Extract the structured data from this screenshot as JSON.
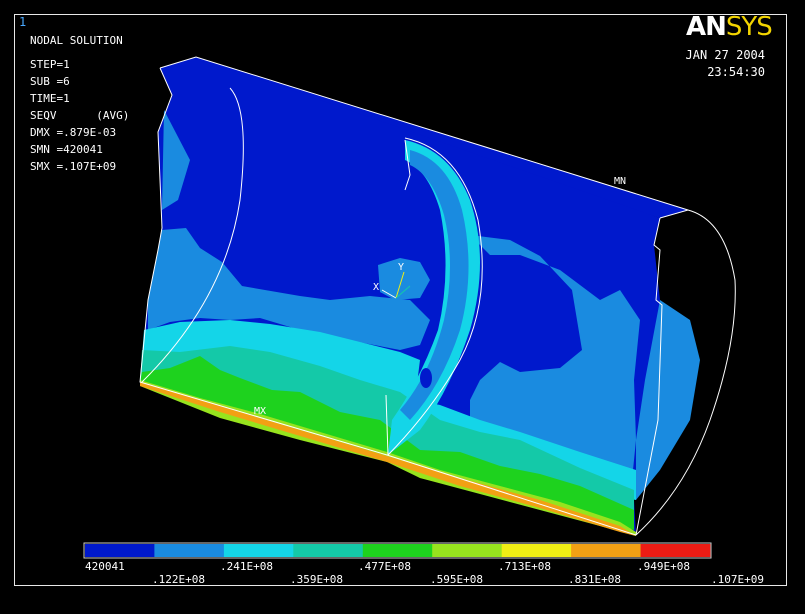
{
  "window_number": "1",
  "header": {
    "title": "NODAL SOLUTION",
    "step": "STEP=1",
    "sub": "SUB =6",
    "time": "TIME=1",
    "seqv": "SEQV      (AVG)",
    "dmx": "DMX =.879E-03",
    "smn": "SMN =420041",
    "smx": "SMX =.107E+09"
  },
  "logo": {
    "an": "AN",
    "sys": "SYS"
  },
  "datetime": {
    "date": "JAN 27 2004",
    "time": "23:54:30"
  },
  "markers": {
    "mn": "MN",
    "mx": "MX",
    "x_axis": "X",
    "y_axis": "Y"
  },
  "legend": {
    "colors": [
      "#0019cc",
      "#1a8be0",
      "#14d5e8",
      "#14c9a8",
      "#1ed21e",
      "#97e31e",
      "#f0ee14",
      "#f2a014",
      "#ed1c14"
    ],
    "labels_top": [
      "420041",
      ".241E+08",
      ".477E+08",
      ".713E+08",
      ".949E+08"
    ],
    "labels_bottom": [
      ".122E+08",
      ".359E+08",
      ".595E+08",
      ".831E+08",
      ".107E+09"
    ]
  },
  "contour_colors": {
    "c1": "#0019cc",
    "c2": "#1a8be0",
    "c3": "#14d5e8",
    "c4": "#14c9a8",
    "c5": "#1ed21e",
    "c6": "#97e31e",
    "c7": "#f0ee14",
    "c8": "#f2a014"
  }
}
